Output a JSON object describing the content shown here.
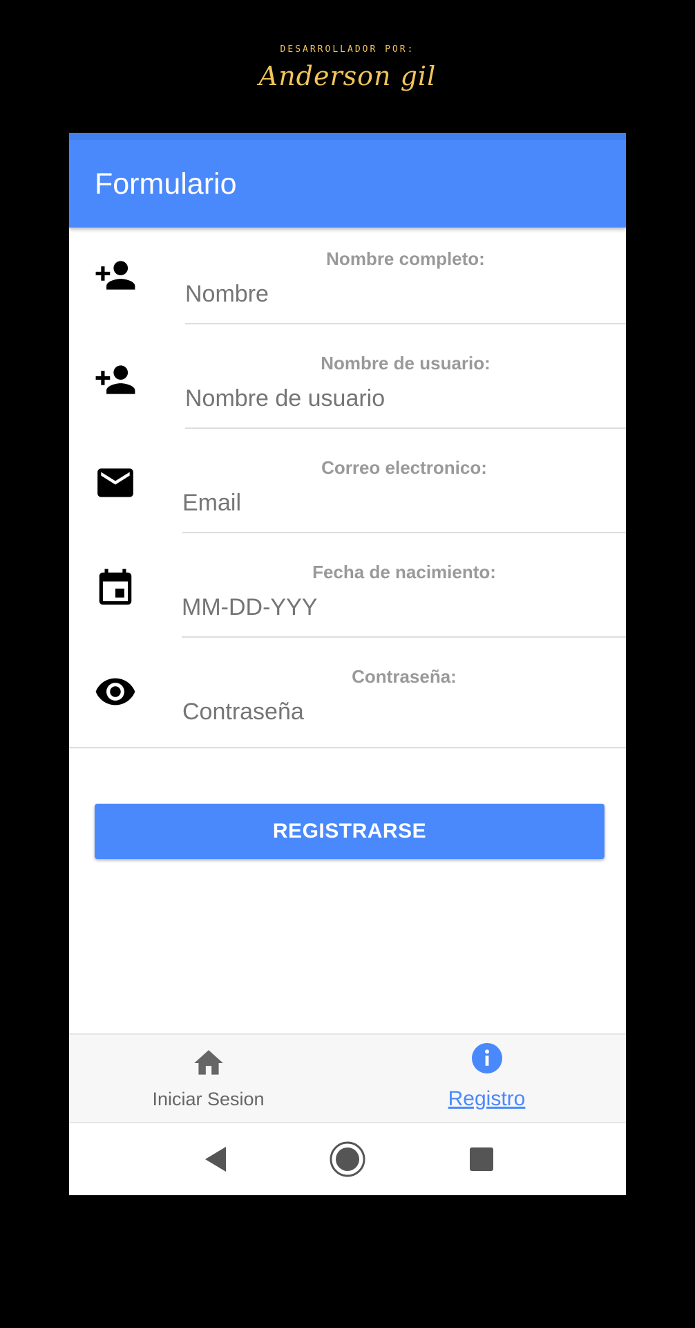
{
  "credit": {
    "caption": "DESARROLLADOR POR:",
    "signature": "Anderson gil"
  },
  "appbar": {
    "title": "Formulario"
  },
  "form": {
    "fields": [
      {
        "label": "Nombre completo:",
        "placeholder": "Nombre",
        "icon": "person-add-icon"
      },
      {
        "label": "Nombre de usuario:",
        "placeholder": "Nombre de usuario",
        "icon": "person-add-icon"
      },
      {
        "label": "Correo electronico:",
        "placeholder": "Email",
        "icon": "mail-icon"
      },
      {
        "label": "Fecha de nacimiento:",
        "placeholder": "MM-DD-YYY",
        "icon": "calendar-icon"
      },
      {
        "label": "Contraseña:",
        "placeholder": "Contraseña",
        "icon": "eye-icon"
      }
    ],
    "submit_label": "REGISTRARSE"
  },
  "tabs": [
    {
      "label": "Iniciar Sesion",
      "icon": "home-icon",
      "active": false
    },
    {
      "label": "Registro",
      "icon": "info-icon",
      "active": true
    }
  ],
  "colors": {
    "primary": "#4a89fb",
    "credit": "#f2c55a",
    "muted": "#999999",
    "inactive_tab": "#666666"
  }
}
